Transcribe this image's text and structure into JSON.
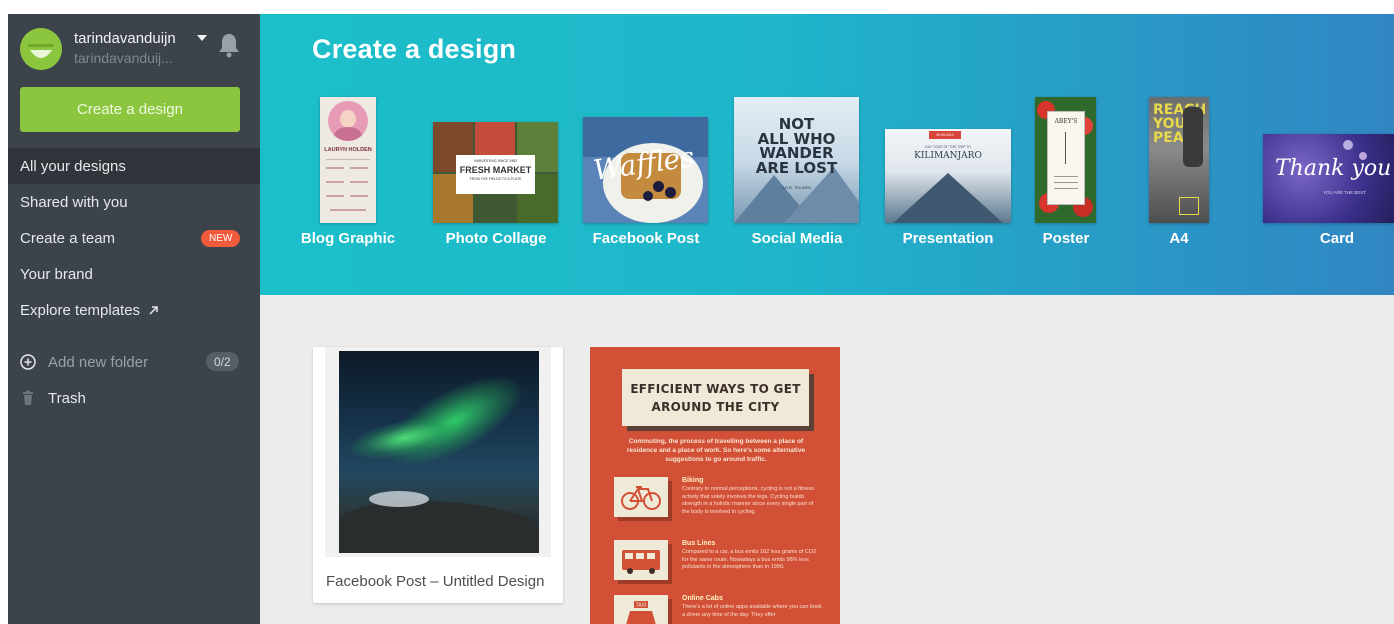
{
  "user": {
    "name": "tarindavanduijn",
    "email": "tarindavanduij..."
  },
  "sidebar": {
    "create_button": "Create a design",
    "nav": [
      {
        "label": "All your designs",
        "active": true
      },
      {
        "label": "Shared with you"
      },
      {
        "label": "Create a team",
        "badge": "NEW"
      },
      {
        "label": "Your brand"
      },
      {
        "label": "Explore templates",
        "icon": "external-arrow-icon"
      }
    ],
    "add_folder_label": "Add new folder",
    "folder_count": "0/2",
    "trash_label": "Trash"
  },
  "hero": {
    "title": "Create a design",
    "types": [
      {
        "label": "Blog Graphic",
        "thumb_title": "LAURYN HOLDEN"
      },
      {
        "label": "Photo Collage",
        "thumb_subtitle": "HARVESTING SINCE 1982",
        "thumb_title": "FRESH MARKET",
        "thumb_tagline": "FROM THE FIELDS TO A PLATE"
      },
      {
        "label": "Facebook Post",
        "thumb_title": "Waffles"
      },
      {
        "label": "Social Media",
        "thumb_lines": [
          "NOT",
          "ALL WHO",
          "WANDER",
          "ARE LOST"
        ],
        "thumb_author": "J.R.R. TOLKIEN"
      },
      {
        "label": "Presentation",
        "thumb_date": "05.09.2014",
        "thumb_kicker": "DAY TOUR OF THE TRIP TO",
        "thumb_title": "KILIMANJARO"
      },
      {
        "label": "Poster",
        "thumb_title": "ABEY'S"
      },
      {
        "label": "A4",
        "thumb_lines": [
          "REACH",
          "YOUR",
          "PEAK"
        ]
      },
      {
        "label": "Card",
        "thumb_title": "Thank you",
        "thumb_subtitle": "YOU ARE THE BEST"
      }
    ]
  },
  "designs": [
    {
      "caption": "Facebook Post – Untitled Design"
    },
    {
      "title_lines": [
        "EFFICIENT WAYS TO GET",
        "AROUND THE CITY"
      ],
      "intro": "Commuting, the process of travelling between a place of residence and a place of work. So here's some alternative suggestions to go around traffic.",
      "items": [
        {
          "title": "Biking",
          "text": "Contrary to normal perceptions, cycling is not a fitness activity that solely involves the legs. Cycling builds strength in a holistic manner since every single part of the body is involved in cycling."
        },
        {
          "title": "Bus Lines",
          "text": "Compared to a car, a bus emits 162 less grams of CO2 for the same route. Nowadays a bus emits 98% less pollutants in the atmosphere than in 1990."
        },
        {
          "title": "Online Cabs",
          "text": "There's a lot of online apps available where you can book a driver any time of the day. They offer",
          "icon_label": "TAXI"
        }
      ]
    }
  ],
  "colors": {
    "sidebar_bg": "#3c434a",
    "accent_green": "#8cc63e",
    "badge_red": "#f15a3a",
    "hero_teal": "#1bbfc9",
    "infographic_red": "#d25036"
  }
}
